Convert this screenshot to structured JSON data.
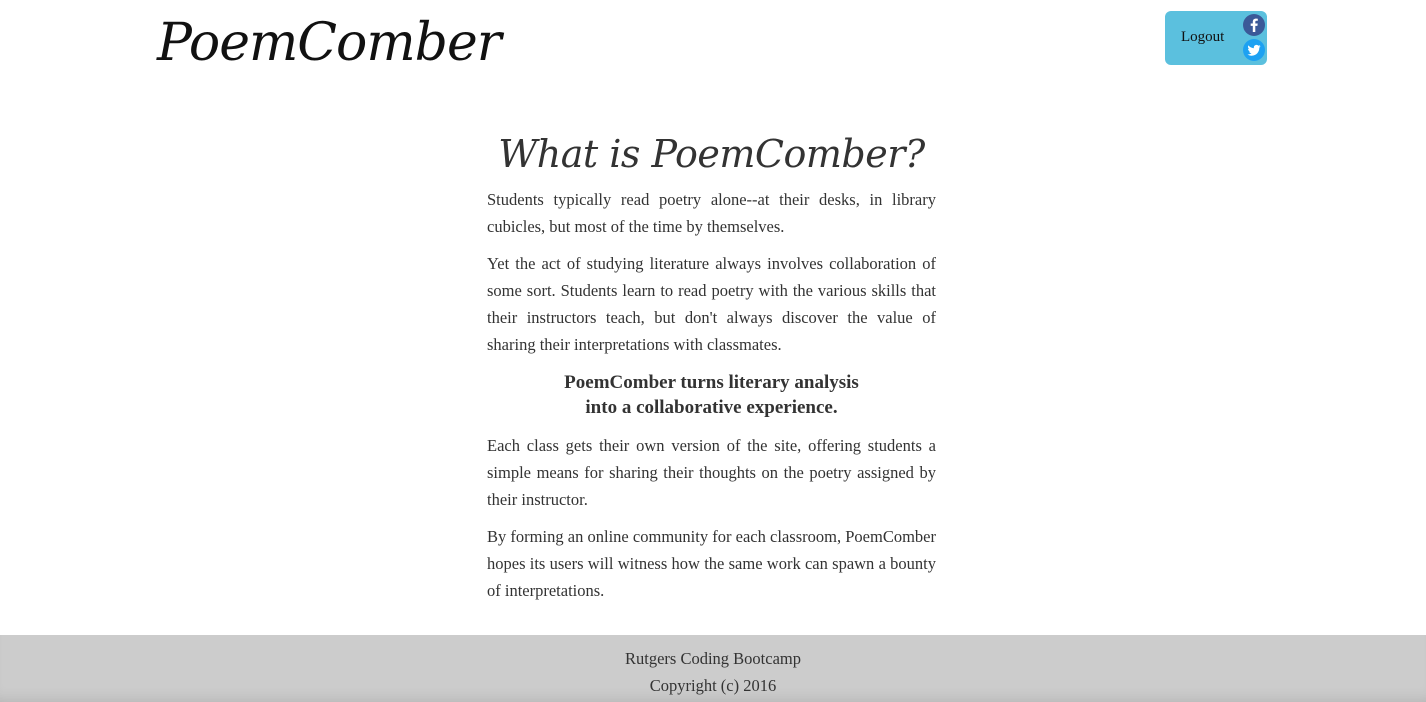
{
  "header": {
    "brand": "PoemComber",
    "logout_label": "Logout",
    "social": [
      {
        "icon": "facebook-icon",
        "color": "#3b5998"
      },
      {
        "icon": "twitter-icon",
        "color": "#1da1f2"
      }
    ],
    "accent_color": "#5bc0de"
  },
  "main": {
    "heading": "What is PoemComber?",
    "paragraph_1": "Students typically read poetry alone--at their desks, in library cubicles, but most of the time by themselves.",
    "paragraph_2": "Yet the act of studying literature always involves collaboration of some sort. Students learn to read poetry with the various skills that their instructors teach, but don't always discover the value of sharing their interpretations with classmates.",
    "callout_line_1": "PoemComber turns literary analysis",
    "callout_line_2": "into a collaborative experience.",
    "paragraph_3": "Each class gets their own version of the site, offering students a simple means for sharing their thoughts on the poetry assigned by their instructor.",
    "paragraph_4": "By forming an online community for each classroom, PoemComber hopes its users will witness how the same work can spawn a bounty of interpretations."
  },
  "footer": {
    "line_1": "Rutgers Coding Bootcamp",
    "line_2": "Copyright (c) 2016",
    "background": "#cccccc"
  }
}
